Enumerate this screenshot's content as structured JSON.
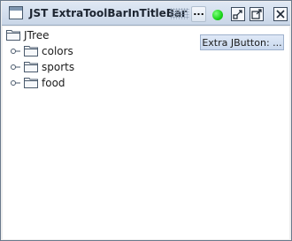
{
  "window": {
    "title": "JST ExtraToolBarInTitleBar",
    "title_toolbar": {
      "dots_label": "..."
    }
  },
  "extra_button": {
    "label": "Extra JButton: ..."
  },
  "tree": {
    "root_label": "JTree",
    "children": [
      {
        "label": "colors"
      },
      {
        "label": "sports"
      },
      {
        "label": "food"
      }
    ]
  },
  "colors": {
    "status_indicator": "#19d419",
    "titlebar": "#cfdbea",
    "extra_button_bg": "#d3e0f2"
  }
}
